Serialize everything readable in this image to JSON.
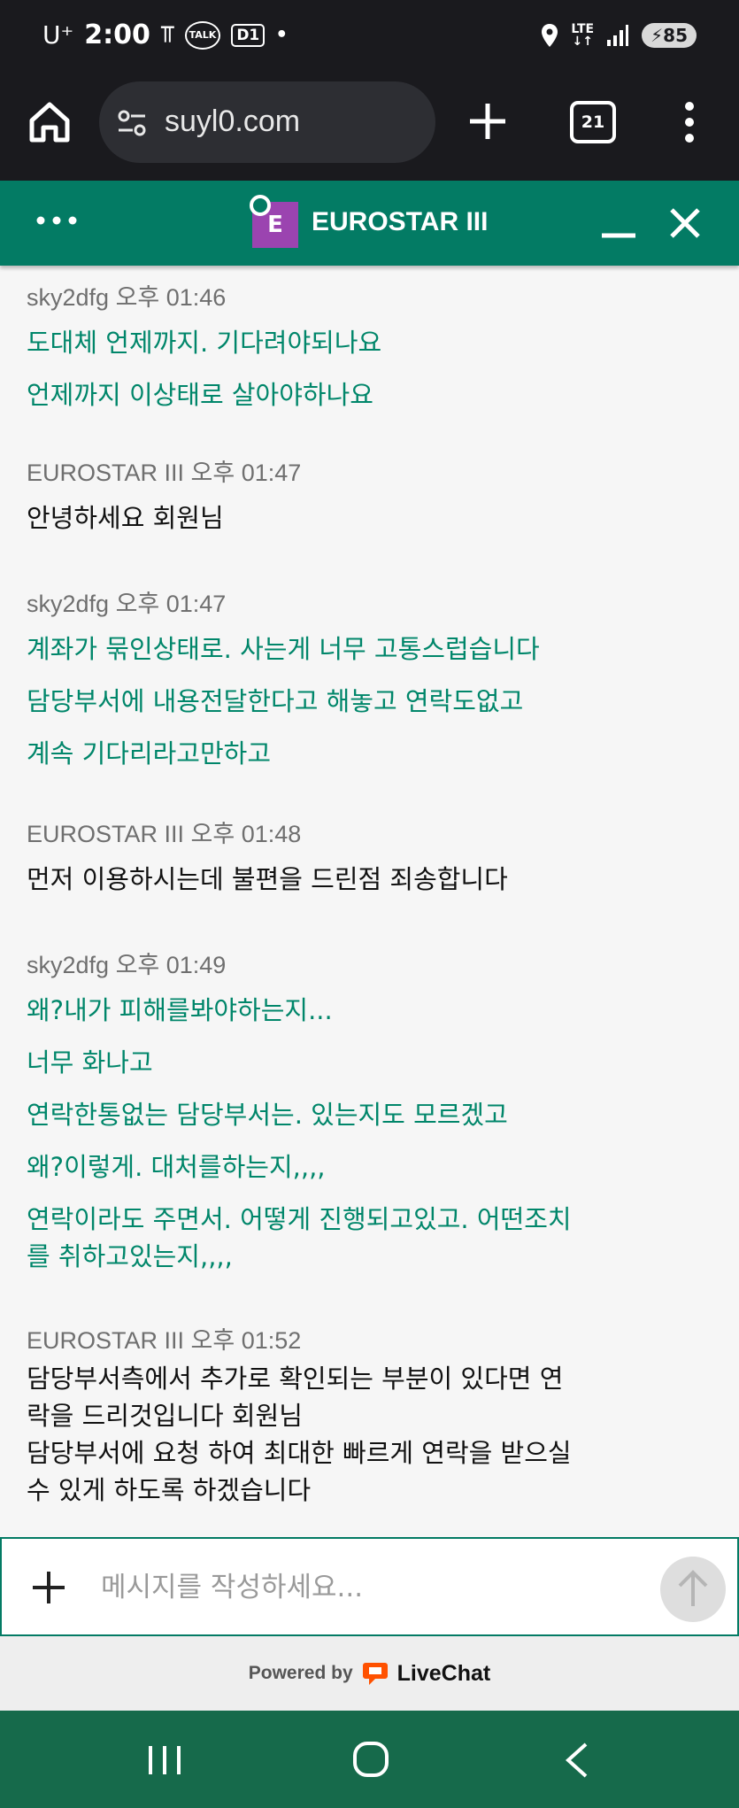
{
  "status_bar": {
    "carrier": "U⁺",
    "time": "2:00",
    "notif_talk": "TALK",
    "notif_d1": "D1",
    "dot": "•",
    "network": "LTE",
    "battery": "85"
  },
  "browser": {
    "url": "suyl0.com",
    "tab_count": "21"
  },
  "chat_header": {
    "logo_letter": "E",
    "title": "EUROSTAR III"
  },
  "messages": [
    {
      "sender": "sky2dfg",
      "time": "오후 01:46",
      "role": "user",
      "lines": [
        "도대체 언제까지. 기다려야되나요",
        "언제까지 이상태로 살아야하나요"
      ]
    },
    {
      "sender": "EUROSTAR III",
      "time": "오후 01:47",
      "role": "agent",
      "lines": [
        "안녕하세요 회원님"
      ]
    },
    {
      "sender": "sky2dfg",
      "time": "오후 01:47",
      "role": "user",
      "lines": [
        "계좌가 묶인상태로. 사는게 너무 고통스럽습니다",
        "담당부서에 내용전달한다고 해놓고 연락도없고",
        "계속 기다리라고만하고"
      ]
    },
    {
      "sender": "EUROSTAR III",
      "time": "오후 01:48",
      "role": "agent",
      "lines": [
        "먼저 이용하시는데 불편을 드린점 죄송합니다"
      ]
    },
    {
      "sender": "sky2dfg",
      "time": "오후 01:49",
      "role": "user",
      "lines": [
        "왜?내가 피해를봐야하는지...",
        "너무 화나고",
        "연락한통없는 담당부서는. 있는지도 모르겠고",
        "왜?이렇게. 대처를하는지,,,,",
        "연락이라도 주면서. 어떻게 진행되고있고. 어떤조치",
        "를 취하고있는지,,,,"
      ]
    },
    {
      "sender": "EUROSTAR III",
      "time": "오후 01:52",
      "role": "agent",
      "lines": [
        "담당부서측에서 추가로 확인되는 부분이 있다면 연",
        "락을 드리것입니다 회원님",
        "담당부서에 요청 하여 최대한 빠르게 연락을 받으실",
        "수 있게 하도록 하겠습니다"
      ]
    }
  ],
  "composer": {
    "placeholder": "메시지를 작성하세요..."
  },
  "footer": {
    "powered_by": "Powered by",
    "brand": "LiveChat"
  },
  "colors": {
    "header_bg": "#037b64",
    "user_text": "#00866a",
    "logo_bg": "#9b44b0",
    "nav_bg": "#166a4b"
  }
}
